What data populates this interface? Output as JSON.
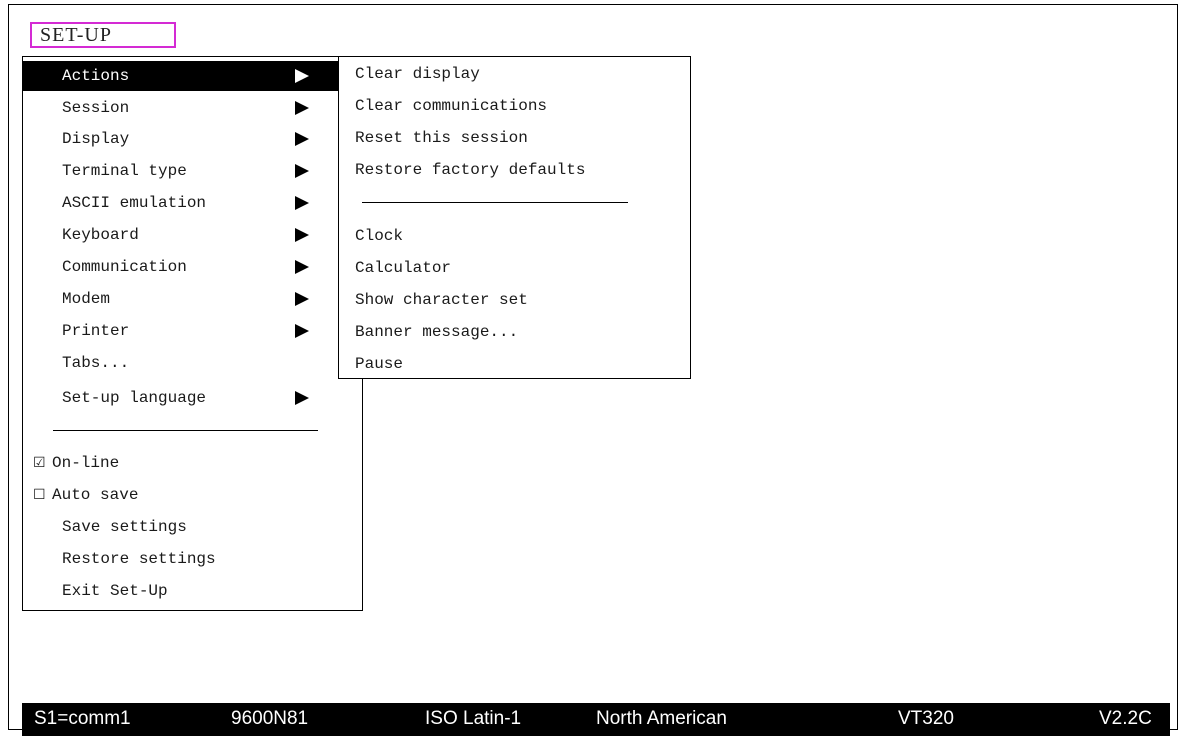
{
  "title": "SET-UP",
  "main_menu": {
    "items": [
      {
        "label": "Actions",
        "has_submenu": true,
        "selected": true
      },
      {
        "label": "Session",
        "has_submenu": true
      },
      {
        "label": "Display",
        "has_submenu": true
      },
      {
        "label": "Terminal type",
        "has_submenu": true
      },
      {
        "label": "ASCII emulation",
        "has_submenu": true
      },
      {
        "label": "Keyboard",
        "has_submenu": true
      },
      {
        "label": "Communication",
        "has_submenu": true
      },
      {
        "label": "Modem",
        "has_submenu": true
      },
      {
        "label": "Printer",
        "has_submenu": true
      },
      {
        "label": "Tabs...",
        "has_submenu": false
      },
      {
        "label": "Set-up language",
        "has_submenu": true
      }
    ],
    "checks": [
      {
        "label": "On-line",
        "checked": true,
        "box": "☑"
      },
      {
        "label": "Auto save",
        "checked": false,
        "box": "☐"
      }
    ],
    "commands": [
      {
        "label": "Save settings"
      },
      {
        "label": "Restore settings"
      },
      {
        "label": "Exit Set-Up"
      }
    ]
  },
  "actions_submenu": {
    "group1": [
      {
        "label": "Clear display"
      },
      {
        "label": "Clear communications"
      },
      {
        "label": "Reset this session"
      },
      {
        "label": "Restore factory defaults"
      }
    ],
    "group2": [
      {
        "label": "Clock"
      },
      {
        "label": "Calculator"
      },
      {
        "label": "Show character set"
      },
      {
        "label": "Banner message..."
      },
      {
        "label": "Pause"
      }
    ]
  },
  "status_bar": {
    "session": "S1=comm1",
    "baud": "9600N81",
    "charset": "ISO Latin-1",
    "keyboard": "North American",
    "terminal": "VT320",
    "version": "V2.2C"
  },
  "colors": {
    "title_border": "#d42ad4",
    "selected_bg": "#000000",
    "status_bg": "#000000"
  }
}
